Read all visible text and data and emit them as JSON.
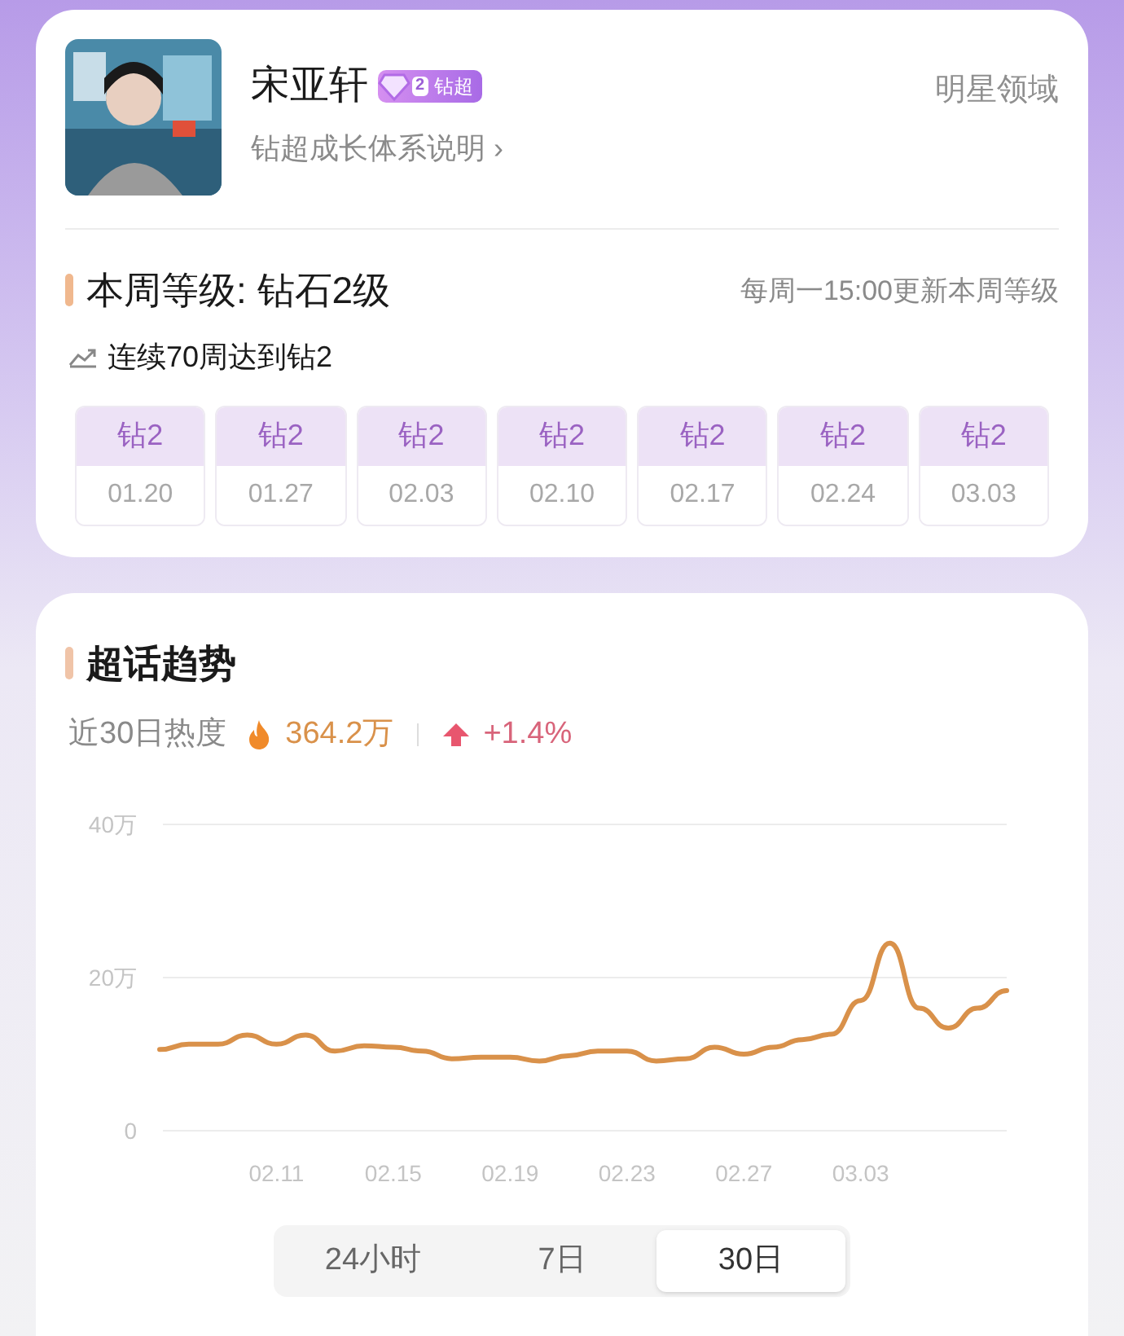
{
  "profile": {
    "name": "宋亚轩",
    "badge": {
      "number": "2",
      "label": "钻超"
    },
    "link": "钻超成长体系说明",
    "chevron": "›",
    "domain": "明星领域"
  },
  "weekly": {
    "title": "本周等级: 钻石2级",
    "note": "每周一15:00更新本周等级",
    "streak": "连续70周达到钻2",
    "weeks": [
      {
        "level": "钻2",
        "date": "01.20"
      },
      {
        "level": "钻2",
        "date": "01.27"
      },
      {
        "level": "钻2",
        "date": "02.03"
      },
      {
        "level": "钻2",
        "date": "02.10"
      },
      {
        "level": "钻2",
        "date": "02.17"
      },
      {
        "level": "钻2",
        "date": "02.24"
      },
      {
        "level": "钻2",
        "date": "03.03"
      }
    ]
  },
  "trend": {
    "title": "超话趋势",
    "heat_label": "近30日热度",
    "heat_value": "364.2万",
    "change": "+1.4%",
    "chart_data": {
      "type": "line",
      "categories": [
        null,
        null,
        null,
        null,
        "02.11",
        null,
        null,
        null,
        "02.15",
        null,
        null,
        null,
        "02.19",
        null,
        null,
        null,
        "02.23",
        null,
        null,
        null,
        "02.27",
        null,
        null,
        null,
        "03.03",
        null,
        null,
        null,
        null,
        null
      ],
      "series": [
        {
          "color": "#d9914a",
          "values": [
            10.6,
            11.3,
            11.3,
            12.5,
            11.3,
            12.5,
            10.4,
            11.1,
            10.9,
            10.4,
            9.4,
            9.6,
            9.6,
            9.1,
            9.8,
            10.4,
            10.4,
            9.1,
            9.4,
            10.9,
            10.0,
            10.9,
            11.9,
            12.6,
            17.0,
            24.5,
            16.0,
            13.4,
            16.0,
            18.3
          ]
        }
      ],
      "ylim": [
        0,
        40
      ],
      "yticks": [
        {
          "value": 0,
          "label": "0"
        },
        {
          "value": 20,
          "label": "20万"
        },
        {
          "value": 40,
          "label": "40万"
        }
      ]
    },
    "ranges": [
      {
        "label": "24小时",
        "selected": false
      },
      {
        "label": "7日",
        "selected": false
      },
      {
        "label": "30日",
        "selected": true
      }
    ]
  }
}
